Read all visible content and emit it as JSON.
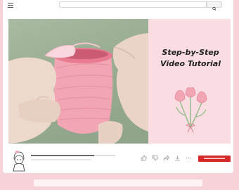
{
  "browser": {
    "menu_icon": "hamburger-menu-icon",
    "search": {
      "placeholder": ""
    },
    "search_icon": "search-icon"
  },
  "video": {
    "title_line1": "Step-by-Step",
    "title_line2": "Video Tutorial",
    "illustration": "tulip-bouquet",
    "photo": "crochet-pouch-in-hands"
  },
  "player": {
    "progress": 0.75,
    "avatar": "crochet-character-avatar",
    "icons": [
      "thumbs-up-icon",
      "thumbs-down-icon",
      "share-icon",
      "download-icon",
      "more-icon"
    ],
    "subscribe_label": "▬▬▬▬▬▬"
  },
  "colors": {
    "page_bg": "#f7d3d9",
    "panel_bg": "#fadde2",
    "accent": "#d42a2a",
    "pouch_pink": "#f2a6b4"
  }
}
